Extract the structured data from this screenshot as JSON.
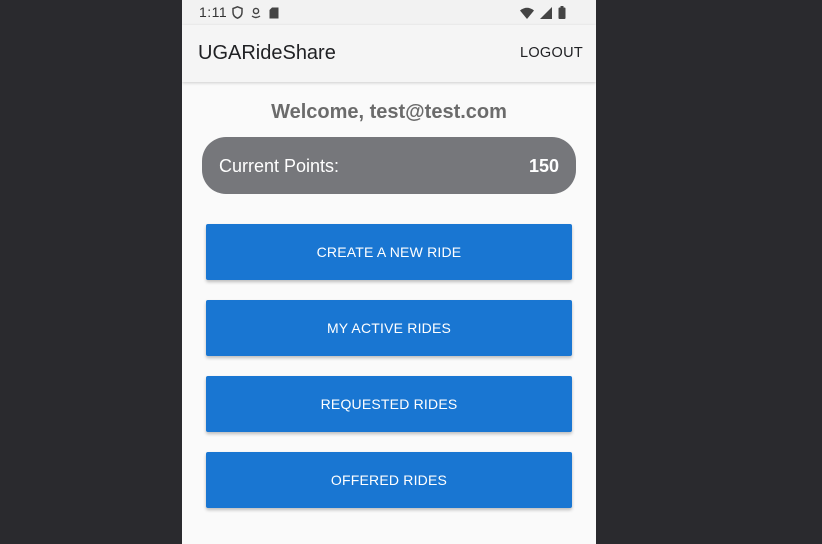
{
  "status_bar": {
    "time": "1:11",
    "icons": [
      "shield-icon",
      "location-icon",
      "sd-card-icon",
      "wifi-icon",
      "signal-icon",
      "battery-icon"
    ]
  },
  "app_bar": {
    "title": "UGARideShare",
    "logout_label": "LOGOUT"
  },
  "main": {
    "welcome": "Welcome, test@test.com",
    "points": {
      "label": "Current Points:",
      "value": "150"
    },
    "buttons": [
      {
        "label": "CREATE A NEW RIDE"
      },
      {
        "label": "MY ACTIVE RIDES"
      },
      {
        "label": "REQUESTED RIDES"
      },
      {
        "label": "OFFERED RIDES"
      }
    ]
  },
  "colors": {
    "primary_button": "#1976d2",
    "points_card": "#76777b",
    "background": "#fafafa",
    "outer_background": "#2a2a2e"
  }
}
